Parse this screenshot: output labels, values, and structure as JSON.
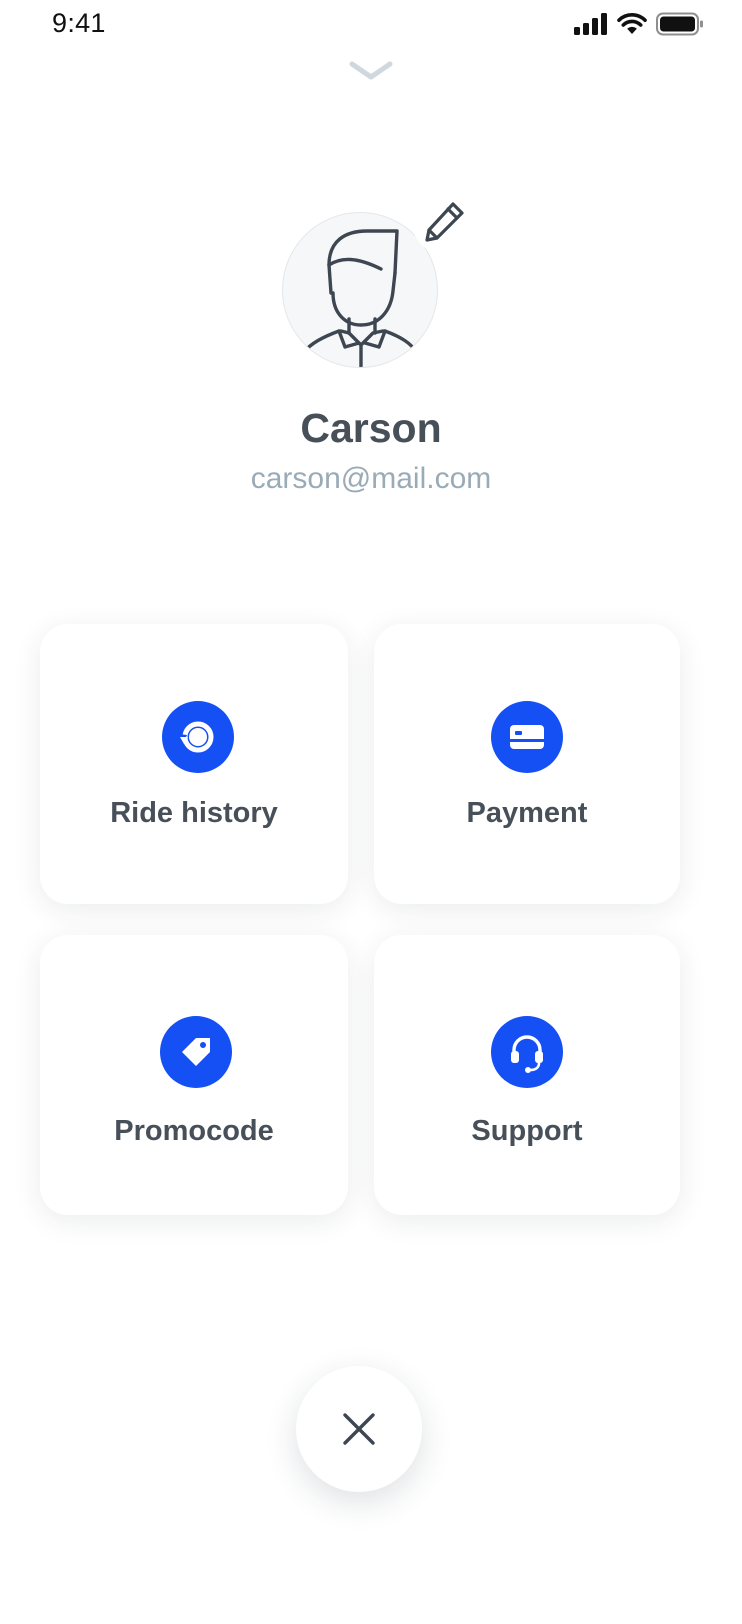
{
  "status_bar": {
    "time": "9:41",
    "icons": [
      "signal-icon",
      "wifi-icon",
      "battery-icon"
    ]
  },
  "sheet": {
    "handle_icon": "chevron-down-icon"
  },
  "profile": {
    "name": "Carson",
    "email": "carson@mail.com",
    "avatar_icon": "user-avatar-icon",
    "edit_icon": "pencil-icon"
  },
  "menu": {
    "items": [
      {
        "label": "Ride history",
        "icon": "history-icon"
      },
      {
        "label": "Payment",
        "icon": "credit-card-icon"
      },
      {
        "label": "Promocode",
        "icon": "tag-icon"
      },
      {
        "label": "Support",
        "icon": "headset-icon"
      }
    ]
  },
  "close": {
    "icon": "close-icon"
  },
  "colors": {
    "accent": "#1550f5",
    "text_dark": "#474f59",
    "text_muted": "#9aabb8",
    "background": "#ffffff"
  }
}
